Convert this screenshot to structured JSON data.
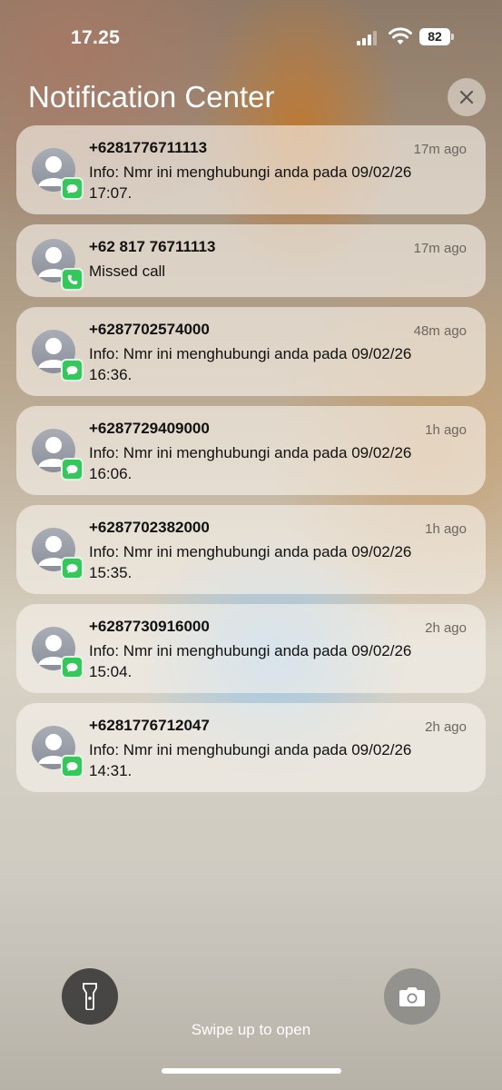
{
  "status_bar": {
    "time": "17.25",
    "battery": "82"
  },
  "header": {
    "title": "Notification Center"
  },
  "notifications": [
    {
      "sender": "+6281776711113",
      "time": "17m ago",
      "line1": "Info: Nmr ini menghubungi anda pada 09/02/26",
      "line2": "17:07.",
      "app_icon": "message-icon"
    },
    {
      "sender": "+62 817 76711113",
      "time": "17m ago",
      "line1": "Missed call",
      "line2": "",
      "app_icon": "phone-icon"
    },
    {
      "sender": "+6287702574000",
      "time": "48m ago",
      "line1": "Info: Nmr ini menghubungi anda pada 09/02/26",
      "line2": "16:36.",
      "app_icon": "message-icon"
    },
    {
      "sender": "+6287729409000",
      "time": "1h ago",
      "line1": "Info: Nmr ini menghubungi anda pada 09/02/26",
      "line2": "16:06.",
      "app_icon": "message-icon"
    },
    {
      "sender": "+6287702382000",
      "time": "1h ago",
      "line1": "Info: Nmr ini menghubungi anda pada 09/02/26",
      "line2": "15:35.",
      "app_icon": "message-icon"
    },
    {
      "sender": "+6287730916000",
      "time": "2h ago",
      "line1": "Info: Nmr ini menghubungi anda pada 09/02/26",
      "line2": "15:04.",
      "app_icon": "message-icon"
    },
    {
      "sender": "+6281776712047",
      "time": "2h ago",
      "line1": "Info: Nmr ini menghubungi anda pada 09/02/26",
      "line2": "14:31.",
      "app_icon": "message-icon"
    }
  ],
  "bottom": {
    "swipe_hint": "Swipe up to open"
  },
  "colors": {
    "badge_green": "#34c759",
    "text_primary": "#111111",
    "text_secondary": "#6b6760"
  }
}
